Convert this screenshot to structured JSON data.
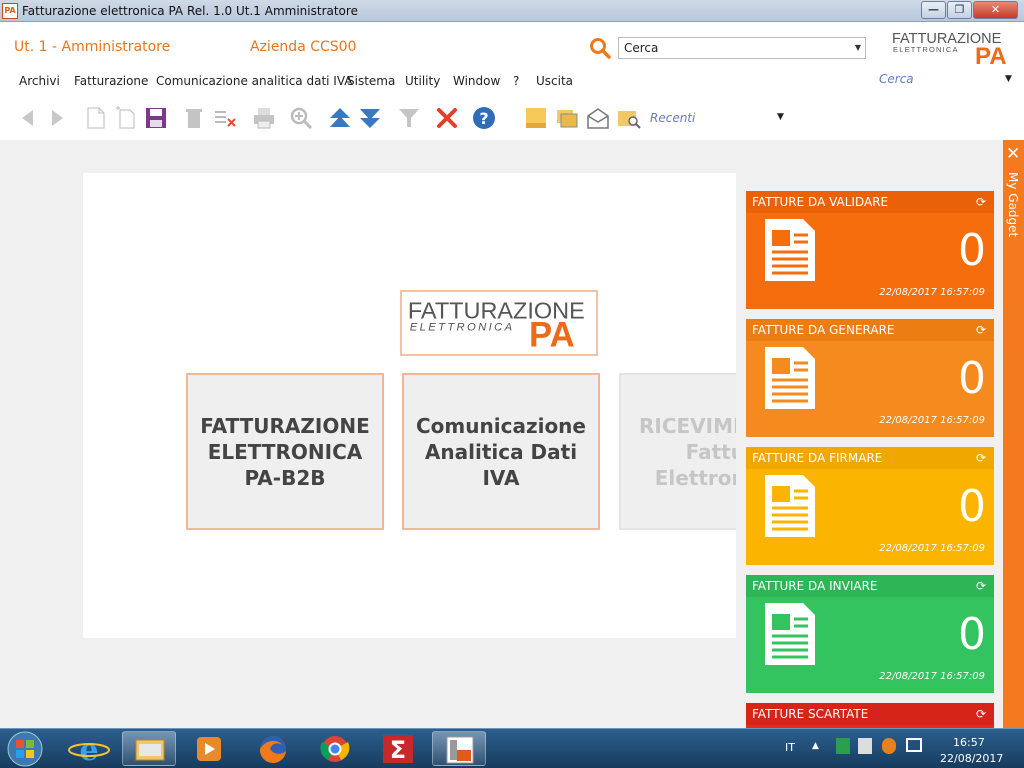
{
  "window": {
    "title": "Fatturazione elettronica PA Rel. 1.0 Ut.1 Amministratore",
    "app_icon": "PA",
    "minimize": "—",
    "maximize": "❐",
    "close": "✕"
  },
  "header": {
    "user": "Ut. 1 - Amministratore",
    "company": "Azienda CCS00",
    "search_value": "Cerca",
    "search2": "Cerca",
    "logo_top": "FATTURAZIONE",
    "logo_mid": "ELETTRONICA",
    "logo_pa": "PA"
  },
  "menu": [
    "Archivi",
    "Fatturazione",
    "Comunicazione analitica dati IVA",
    "Sistema",
    "Utility",
    "Window",
    "?",
    "Uscita"
  ],
  "toolbar": {
    "recent_label": "Recenti"
  },
  "center": {
    "logo_top": "FATTURAZIONE",
    "logo_mid": "ELETTRONICA",
    "logo_pa": "PA"
  },
  "tiles": [
    {
      "label": "FATTURAZIONE\nELETTRONICA\nPA-B2B"
    },
    {
      "label": "Comunicazione\nAnalitica Dati\nIVA"
    },
    {
      "label": "RICEVIMENTO\n   Fatture\n  Elettroniche"
    }
  ],
  "gadgets": [
    {
      "title": "FATTURE DA VALIDARE",
      "count": "0",
      "timestamp": "22/08/2017 16:57:09",
      "color": "#f56d0d",
      "head_color": "#e9620a"
    },
    {
      "title": "FATTURE DA GENERARE",
      "count": "0",
      "timestamp": "22/08/2017 16:57:09",
      "color": "#f58a1e",
      "head_color": "#eb7d13"
    },
    {
      "title": "FATTURE DA FIRMARE",
      "count": "0",
      "timestamp": "22/08/2017 16:57:09",
      "color": "#fbb500",
      "head_color": "#f0a800"
    },
    {
      "title": "FATTURE DA INVIARE",
      "count": "0",
      "timestamp": "22/08/2017 16:57:09",
      "color": "#33c45f",
      "head_color": "#2db556"
    },
    {
      "title": "FATTURE SCARTATE",
      "count": "",
      "timestamp": "",
      "color": "#e02b1f",
      "head_color": "#d62418"
    }
  ],
  "my_gadget": {
    "label": "My Gadget",
    "close": "✕"
  },
  "taskbar": {
    "lang": "IT",
    "time": "16:57",
    "date": "22/08/2017"
  }
}
